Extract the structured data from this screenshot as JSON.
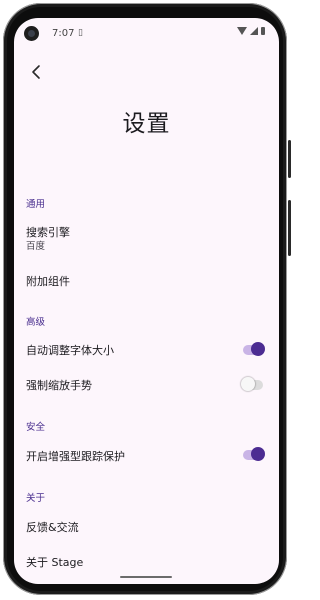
{
  "status_bar": {
    "time": "7:07",
    "notification_icon": "sim-card-icon"
  },
  "header": {
    "back_icon": "arrow-back-icon",
    "title": "设置"
  },
  "sections": {
    "general": {
      "label": "通用",
      "search_engine": {
        "label": "搜索引擎",
        "value": "百度"
      },
      "addons": {
        "label": "附加组件"
      }
    },
    "advanced": {
      "label": "高级",
      "auto_font_size": {
        "label": "自动调整字体大小",
        "enabled": true
      },
      "force_zoom": {
        "label": "强制缩放手势",
        "enabled": false
      }
    },
    "security": {
      "label": "安全",
      "tracking_protection": {
        "label": "开启增强型跟踪保护",
        "enabled": true
      }
    },
    "about": {
      "label": "关于",
      "feedback": {
        "label": "反馈&交流"
      },
      "about_stage": {
        "label": "关于 Stage"
      }
    }
  },
  "colors": {
    "accent": "#4c2c92",
    "section_label": "#4a2f8f",
    "background": "#fdf6fc"
  }
}
